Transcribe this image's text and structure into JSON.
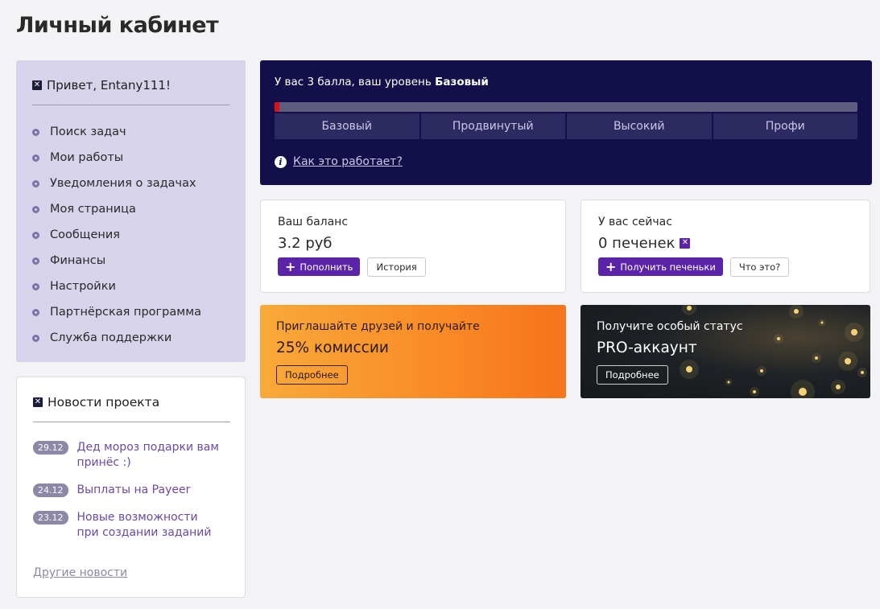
{
  "page": {
    "title": "Личный кабинет"
  },
  "sidebar": {
    "greeting": "Привет, Entany111!",
    "items": [
      {
        "label": "Поиск задач"
      },
      {
        "label": "Мои работы"
      },
      {
        "label": "Уведомления о задачах"
      },
      {
        "label": "Моя страница"
      },
      {
        "label": "Сообщения"
      },
      {
        "label": "Финансы"
      },
      {
        "label": "Настройки"
      },
      {
        "label": "Партнёрская программа"
      },
      {
        "label": "Служба поддержки"
      }
    ]
  },
  "news": {
    "title": "Новости проекта",
    "items": [
      {
        "date": "29.12",
        "text": "Дед мороз подарки вам принёс :)"
      },
      {
        "date": "24.12",
        "text": "Выплаты на Payeer"
      },
      {
        "date": "23.12",
        "text": "Новые возможности при создании заданий"
      }
    ],
    "more_label": "Другие новости"
  },
  "level": {
    "text_prefix": "У вас 3 балла, ваш уровень ",
    "current_level": "Базовый",
    "progress_fraction": 0.008,
    "steps": [
      "Базовый",
      "Продвинутый",
      "Высокий",
      "Профи"
    ],
    "how_link": "Как это работает?",
    "accent_color": "#120f4a"
  },
  "balance": {
    "label": "Ваш баланс",
    "value": "3.2 руб",
    "topup_label": "Пополнить",
    "history_label": "История"
  },
  "cookies": {
    "label": "У вас сейчас",
    "value": "0 печенек",
    "get_label": "Получить печеньки",
    "what_label": "Что это?"
  },
  "referral": {
    "label": "Приглашайте друзей и получайте",
    "value": "25% комиссии",
    "more_label": "Подробнее"
  },
  "pro": {
    "label": "Получите особый статус",
    "value": "PRO-аккаунт",
    "more_label": "Подробнее"
  }
}
